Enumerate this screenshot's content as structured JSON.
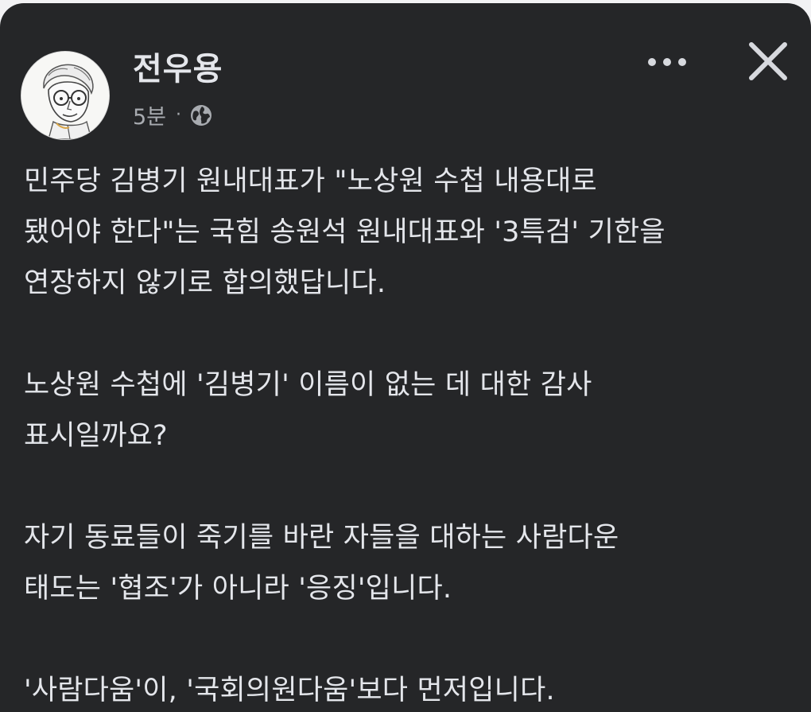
{
  "post": {
    "author_name": "전우용",
    "timestamp": "5분",
    "separator": "·",
    "privacy_icon": "globe-icon",
    "more_icon": "more-horizontal-icon",
    "close_icon": "close-icon",
    "paragraphs": [
      "민주당 김병기 원내대표가 \"노상원 수첩 내용대로\n됐어야 한다\"는 국힘 송원석 원내대표와 '3특검' 기한을\n연장하지 않기로 합의했답니다.",
      "노상원 수첩에 '김병기' 이름이 없는 데 대한 감사\n표시일까요?",
      "자기 동료들이 죽기를 바란 자들을 대하는 사람다운\n태도는 '협조'가 아니라 '응징'입니다.",
      "'사람다움'이, '국회의원다움'보다 먼저입니다."
    ]
  },
  "colors": {
    "background": "#252628",
    "text_primary": "#e4e6eb",
    "text_secondary": "#a8abb0"
  }
}
